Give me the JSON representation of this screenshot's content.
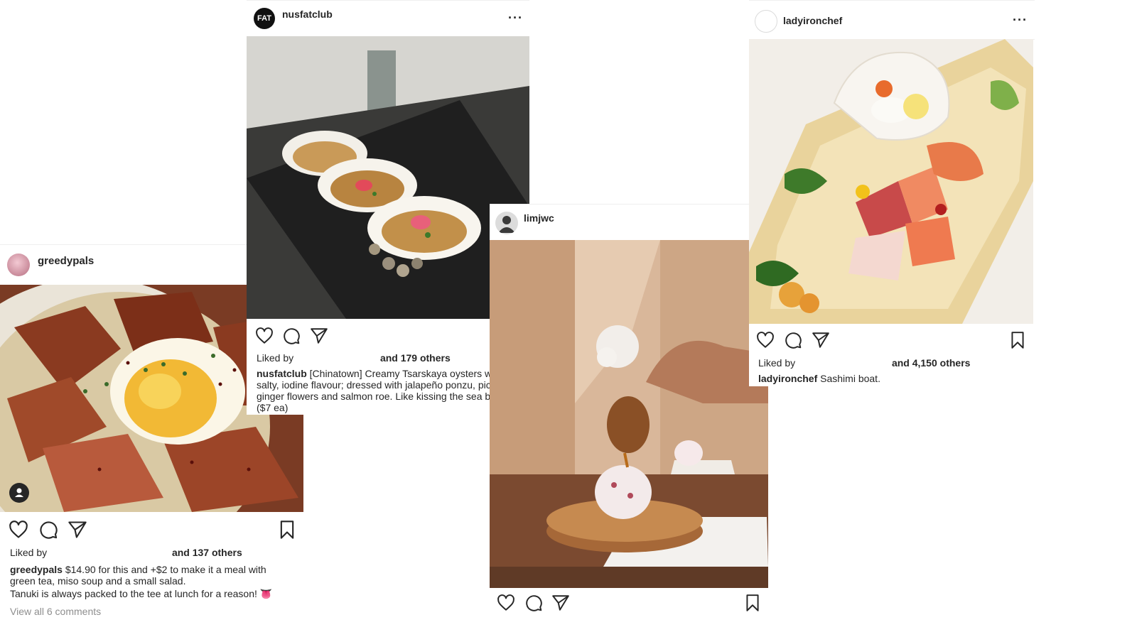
{
  "posts": {
    "greedypals": {
      "username": "greedypals",
      "liked_by_label": "Liked by",
      "others": "and 137 others",
      "caption_user": "greedypals",
      "caption_line1": "$14.90 for this and +$2 to make it a meal with",
      "caption_line2": "green tea, miso soup and a small salad.",
      "caption_line3": "Tanuki is always packed to the tee at lunch for a reason! 👅",
      "comments_link": "View all 6 comments"
    },
    "nusfatclub": {
      "username": "nusfatclub",
      "avatar_text": "FAT",
      "more": "···",
      "liked_by_label": "Liked by",
      "others": "and 179 others",
      "caption_user": "nusfatclub",
      "caption_line1": "[Chinatown] Creamy Tsarskaya oysters wi",
      "caption_line2": "salty, iodine flavour; dressed with jalapeño ponzu, pic",
      "caption_line3": "ginger flowers and salmon roe. Like kissing the sea b",
      "caption_line4": "($7 ea)"
    },
    "limjwc": {
      "username": "limjwc"
    },
    "ladyironchef": {
      "username": "ladyironchef",
      "more": "···",
      "liked_by_label": "Liked by",
      "others": "and 4,150 others",
      "caption_user": "ladyironchef",
      "caption_text": "Sashimi boat."
    }
  },
  "icons": [
    "heart-icon",
    "comment-icon",
    "share-icon",
    "bookmark-icon",
    "user-tag-icon"
  ]
}
